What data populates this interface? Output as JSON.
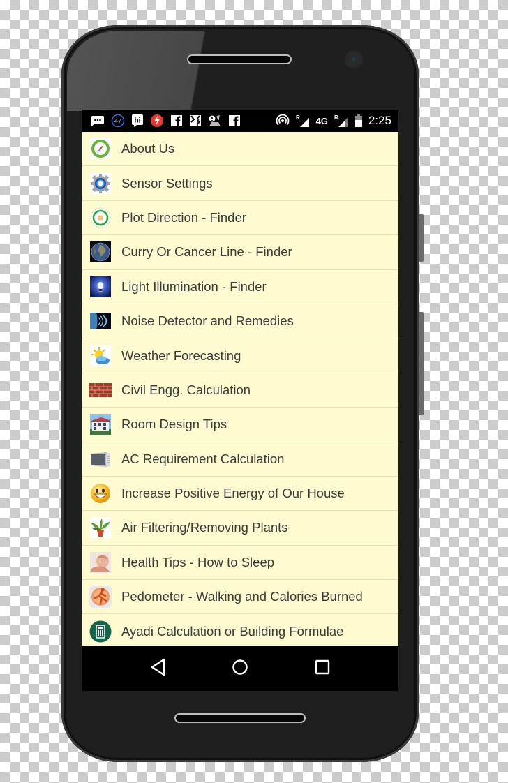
{
  "status_bar": {
    "notification_icons": [
      "chat-bubble-icon",
      "badge-47-icon",
      "hike-app-icon",
      "flash-app-icon",
      "facebook-icon",
      "facebook-icon",
      "app-notification-icon",
      "facebook-icon"
    ],
    "badge_count": "47",
    "hike_label": "hi",
    "network_label": "4G",
    "roaming_label": "R",
    "time": "2:25"
  },
  "menu": {
    "items": [
      {
        "label": "About Us",
        "icon": "compass-icon"
      },
      {
        "label": "Sensor Settings",
        "icon": "gear-icon"
      },
      {
        "label": "Plot Direction - Finder",
        "icon": "direction-dial-icon"
      },
      {
        "label": "Curry Or Cancer Line - Finder",
        "icon": "globe-icon"
      },
      {
        "label": "Light Illumination - Finder",
        "icon": "light-bulb-icon"
      },
      {
        "label": "Noise Detector and Remedies",
        "icon": "sound-waves-icon"
      },
      {
        "label": "Weather Forecasting",
        "icon": "sun-cloud-icon"
      },
      {
        "label": "Civil Engg. Calculation",
        "icon": "brick-wall-icon"
      },
      {
        "label": "Room Design Tips",
        "icon": "house-icon"
      },
      {
        "label": "AC Requirement Calculation",
        "icon": "air-conditioner-icon"
      },
      {
        "label": "Increase Positive Energy of Our House",
        "icon": "smiley-icon"
      },
      {
        "label": "Air Filtering/Removing Plants",
        "icon": "potted-plant-icon"
      },
      {
        "label": "Health Tips - How to Sleep",
        "icon": "sleeping-baby-icon"
      },
      {
        "label": "Pedometer - Walking and Calories Burned",
        "icon": "runner-icon"
      },
      {
        "label": "Ayadi Calculation or Building Formulae",
        "icon": "calculator-icon"
      }
    ]
  },
  "navigation": {
    "back": "back-icon",
    "home": "home-icon",
    "recents": "recents-icon"
  },
  "colors": {
    "list_background": "#fffbd0",
    "divider": "#e6e1b4",
    "text": "#3c3c3c"
  }
}
